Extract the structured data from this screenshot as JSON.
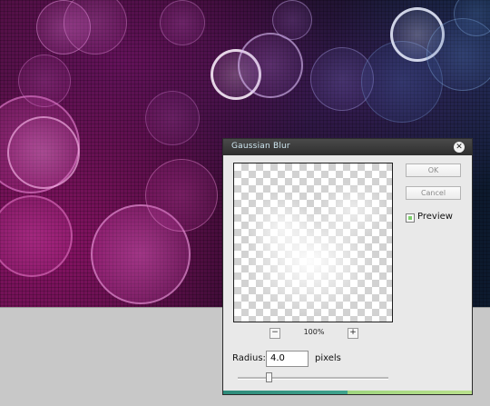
{
  "dialog": {
    "title": "Gaussian Blur",
    "ok_label": "OK",
    "cancel_label": "Cancel",
    "preview_label": "Preview",
    "preview_checked": true,
    "zoom_out_label": "−",
    "zoom_in_label": "+",
    "zoom_value": "100%",
    "radius_label": "Radius:",
    "radius_value": "4.0",
    "radius_unit": "pixels",
    "radius_slider_fraction": 0.21,
    "accent_colors": [
      "#2e8b7a",
      "#9fd57f"
    ]
  },
  "icons": {
    "close": "close-icon",
    "zoom_out": "minus-icon",
    "zoom_in": "plus-icon"
  }
}
